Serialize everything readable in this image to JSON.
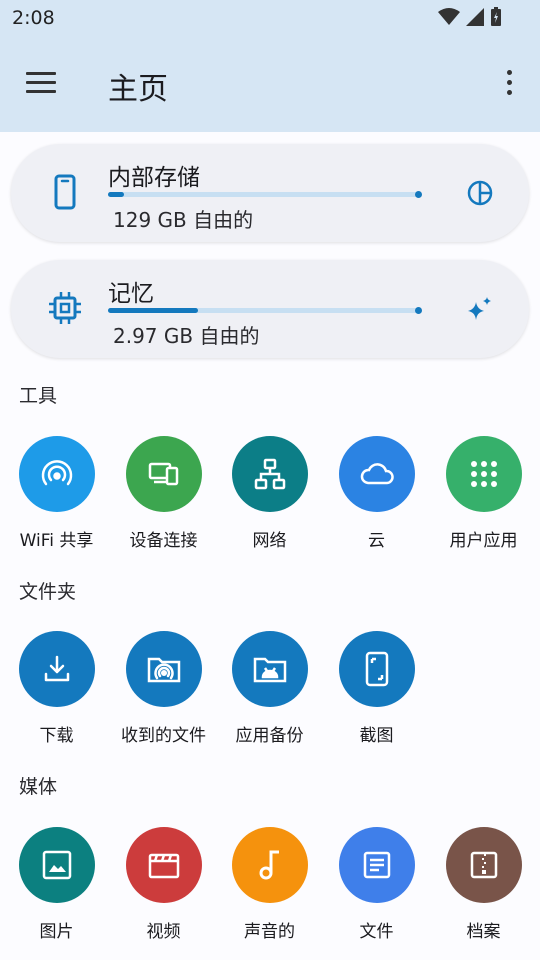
{
  "status": {
    "time": "2:08"
  },
  "appbar": {
    "title": "主页",
    "menu_icon": "menu-icon",
    "more_icon": "more-vert-icon"
  },
  "storage": {
    "title": "内部存储",
    "free": "129 GB 自由的",
    "used_fraction": 0.05,
    "icon": "phone-icon",
    "action_icon": "pie-chart-icon"
  },
  "memory": {
    "title": "记忆",
    "free": "2.97 GB 自由的",
    "used_fraction": 0.29,
    "icon": "chip-icon",
    "action_icon": "sparkle-icon"
  },
  "sections": {
    "tools": {
      "label": "工具",
      "items": [
        {
          "label": "WiFi 共享",
          "icon": "wifi-share-icon",
          "color": "#1e9be8"
        },
        {
          "label": "设备连接",
          "icon": "devices-icon",
          "color": "#3ca64f"
        },
        {
          "label": "网络",
          "icon": "network-icon",
          "color": "#0c7e87"
        },
        {
          "label": "云",
          "icon": "cloud-icon",
          "color": "#2b83e3"
        },
        {
          "label": "用户应用",
          "icon": "apps-grid-icon",
          "color": "#36b06b"
        }
      ]
    },
    "folders": {
      "label": "文件夹",
      "items": [
        {
          "label": "下载",
          "icon": "download-icon",
          "color": "#1479be"
        },
        {
          "label": "收到的文件",
          "icon": "received-folder-icon",
          "color": "#1479be"
        },
        {
          "label": "应用备份",
          "icon": "android-folder-icon",
          "color": "#1479be"
        },
        {
          "label": "截图",
          "icon": "screenshot-icon",
          "color": "#1479be"
        }
      ]
    },
    "media": {
      "label": "媒体",
      "items": [
        {
          "label": "图片",
          "icon": "image-icon",
          "color": "#0c8080"
        },
        {
          "label": "视频",
          "icon": "video-icon",
          "color": "#cc3c3c"
        },
        {
          "label": "声音的",
          "icon": "music-icon",
          "color": "#f5920d"
        },
        {
          "label": "文件",
          "icon": "document-icon",
          "color": "#3f7fea"
        },
        {
          "label": "档案",
          "icon": "archive-icon",
          "color": "#795449"
        }
      ]
    }
  }
}
